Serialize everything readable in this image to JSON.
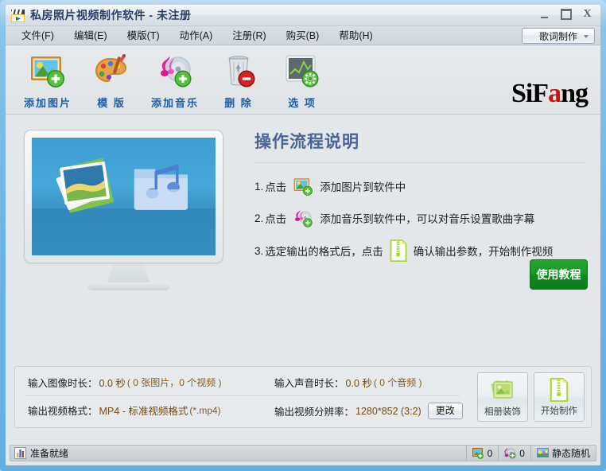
{
  "window": {
    "title": "私房照片视频制作软件 - 未注册",
    "icon": "film-clapper-icon",
    "buttons": {
      "minimize": "minimize-icon",
      "maximize": "maximize-icon",
      "close": "X"
    }
  },
  "menubar": {
    "items": [
      {
        "label": "文件(F)",
        "name": "menu-file"
      },
      {
        "label": "编辑(E)",
        "name": "menu-edit"
      },
      {
        "label": "模版(T)",
        "name": "menu-template"
      },
      {
        "label": "动作(A)",
        "name": "menu-action"
      },
      {
        "label": "注册(R)",
        "name": "menu-register"
      },
      {
        "label": "购买(B)",
        "name": "menu-buy"
      },
      {
        "label": "帮助(H)",
        "name": "menu-help"
      }
    ],
    "combo": {
      "value": "歌词制作",
      "caret": "chevron-down-icon"
    }
  },
  "toolbar": {
    "buttons": [
      {
        "label": "添加图片",
        "icon": "add-picture-icon"
      },
      {
        "label": "模 版",
        "icon": "palette-icon"
      },
      {
        "label": "添加音乐",
        "icon": "add-music-icon"
      },
      {
        "label": "删 除",
        "icon": "delete-trash-icon"
      },
      {
        "label": "选 项",
        "icon": "options-icon"
      }
    ],
    "brand": {
      "part1": "SiF",
      "part_red": "a",
      "part2": "ng",
      "accent_color": "#cc1111"
    }
  },
  "main": {
    "preview": {
      "name": "monitor-preview",
      "icon": "photos-and-music-folder-illustration"
    },
    "instructions": {
      "title": "操作流程说明",
      "steps": [
        {
          "num": "1.",
          "before": "点击",
          "icon": "add-picture-icon",
          "after": "添加图片到软件中"
        },
        {
          "num": "2.",
          "before": "点击",
          "icon": "add-music-icon",
          "after": "添加音乐到软件中，可以对音乐设置歌曲字幕"
        },
        {
          "num": "3.",
          "before": "选定输出的格式后，点击",
          "icon": "start-make-icon",
          "after": "确认输出参数，开始制作视频"
        }
      ]
    },
    "tutorial_button": {
      "label": "使用教程",
      "color": "#149424"
    }
  },
  "info_panel": {
    "image_duration": {
      "label": "输入图像时长：",
      "value": "0.0 秒",
      "detail": "( 0 张图片，0 个视频 )"
    },
    "audio_duration": {
      "label": "输入声音时长：",
      "value": "0.0 秒",
      "detail": "( 0 个音频 )"
    },
    "output_format": {
      "label": "输出视频格式：",
      "value": "MP4 - 标准视频格式",
      "ext": "(*.mp4)"
    },
    "output_resolution": {
      "label": "输出视频分辨率：",
      "value": "1280*852 (3:2)",
      "change_label": "更改"
    },
    "buttons": [
      {
        "label": "相册装饰",
        "icon": "album-decoration-icon"
      },
      {
        "label": "开始制作",
        "icon": "start-make-icon"
      }
    ]
  },
  "statusbar": {
    "icon": "chart-bars-icon",
    "text": "准备就绪",
    "cells": [
      {
        "icon": "picture-count-icon",
        "value": "0"
      },
      {
        "icon": "music-count-icon",
        "value": "0"
      },
      {
        "icon": "transition-icon",
        "value": "静态随机"
      }
    ]
  }
}
